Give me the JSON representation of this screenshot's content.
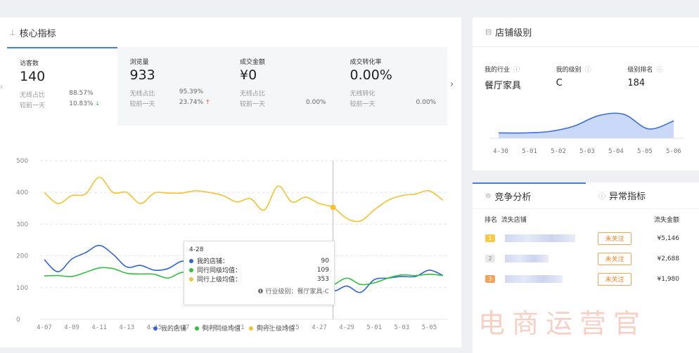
{
  "core": {
    "title": "核心指标",
    "tabs": [
      {
        "label": "访客数",
        "value": "140",
        "r1k": "无线占比",
        "r1v": "88.57%",
        "r2k": "较前一天",
        "r2v": "10.83%",
        "trend": "↓"
      },
      {
        "label": "浏览量",
        "value": "933",
        "r1k": "无线占比",
        "r1v": "95.39%",
        "r2k": "较前一天",
        "r2v": "23.74%",
        "trend": "↑"
      },
      {
        "label": "成交金额",
        "value": "¥0",
        "r1k": "无线占比",
        "r1v": "",
        "r2k": "较前一天",
        "r2v": "0.00%",
        "trend": ""
      },
      {
        "label": "成交转化率",
        "value": "0.00%",
        "r1k": "无线转化",
        "r1v": "",
        "r2k": "较前一天",
        "r2v": "0.00%",
        "trend": ""
      }
    ]
  },
  "chart_data": {
    "type": "line",
    "x": [
      "4-07",
      "4-08",
      "4-09",
      "4-10",
      "4-11",
      "4-12",
      "4-13",
      "4-14",
      "4-15",
      "4-16",
      "4-17",
      "4-18",
      "4-19",
      "4-20",
      "4-21",
      "4-22",
      "4-23",
      "4-24",
      "4-25",
      "4-26",
      "4-27",
      "4-28",
      "4-29",
      "4-30",
      "5-01",
      "5-02",
      "5-03",
      "5-04",
      "5-05",
      "5-06"
    ],
    "xticks": [
      "4-07",
      "4-09",
      "4-11",
      "4-13",
      "4-15",
      "4-17",
      "4-19",
      "4-21",
      "4-23",
      "4-25",
      "4-27",
      "4-29",
      "5-01",
      "5-03",
      "5-05"
    ],
    "ylim": [
      0,
      500
    ],
    "yticks": [
      0,
      100,
      200,
      300,
      400,
      500
    ],
    "grid": true,
    "legend": "bottom",
    "series": [
      {
        "name": "我的店铺",
        "color": "#2f63d9",
        "values": [
          188,
          150,
          190,
          210,
          233,
          205,
          165,
          170,
          155,
          160,
          183,
          175,
          165,
          150,
          140,
          135,
          140,
          135,
          125,
          110,
          125,
          90,
          105,
          85,
          125,
          130,
          135,
          135,
          155,
          138
        ]
      },
      {
        "name": "同行同级均值",
        "color": "#30c040",
        "values": [
          137,
          138,
          135,
          148,
          162,
          160,
          145,
          143,
          142,
          130,
          148,
          145,
          140,
          145,
          135,
          140,
          158,
          148,
          125,
          115,
          110,
          109,
          130,
          110,
          115,
          130,
          140,
          138,
          142,
          138
        ]
      },
      {
        "name": "同行上级均值",
        "color": "#f5c12e",
        "values": [
          400,
          365,
          390,
          395,
          448,
          400,
          400,
          365,
          398,
          398,
          398,
          405,
          400,
          390,
          370,
          380,
          345,
          420,
          370,
          385,
          365,
          353,
          318,
          310,
          345,
          375,
          390,
          395,
          405,
          375
        ]
      }
    ]
  },
  "tooltip": {
    "date": "4-28",
    "rows": [
      {
        "label": "我的店铺：",
        "value": "90",
        "color": "#2f63d9"
      },
      {
        "label": "同行同级均值：",
        "value": "109",
        "color": "#30c040"
      },
      {
        "label": "同行上级均值：",
        "value": "353",
        "color": "#f5c12e"
      }
    ],
    "footer": "❶ 行业级别：餐厅家具-C"
  },
  "shop": {
    "title": "店铺级别",
    "cols": [
      {
        "k": "我的行业",
        "v": "餐厅家具"
      },
      {
        "k": "我的级别",
        "v": "C"
      },
      {
        "k": "级别排名",
        "v": "184"
      }
    ],
    "xticks": [
      "4-30",
      "5-01",
      "5-02",
      "5-03",
      "5-04",
      "5-05",
      "5-06"
    ],
    "values": [
      174,
      174,
      175,
      179,
      187,
      188,
      177,
      183
    ]
  },
  "competition": {
    "tab_active": "竞争分析",
    "tab_other": "异常指标",
    "col_rank": "排名",
    "col_shop": "流失店铺",
    "col_amount": "流失金额",
    "rows": [
      {
        "rank": "1",
        "badge": "未关注",
        "amount": "¥5,146"
      },
      {
        "rank": "2",
        "badge": "未关注",
        "amount": "¥2,688"
      },
      {
        "rank": "3",
        "badge": "未关注",
        "amount": "¥1,980"
      }
    ]
  },
  "watermark": "电商运营官",
  "colors": {
    "accent": "#3d7bff",
    "fill": "#bdd0f7"
  }
}
